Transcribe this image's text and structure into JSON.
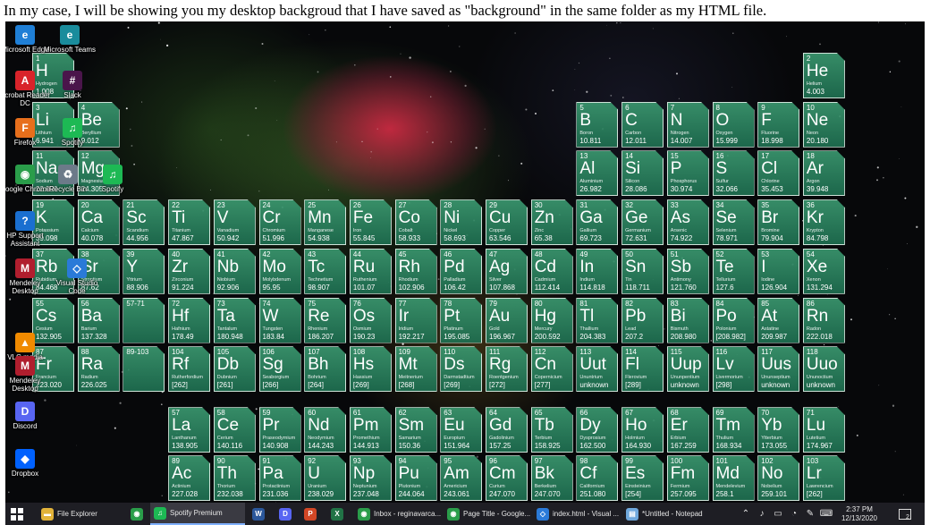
{
  "caption": "In my case, I will be showing you my desktop backgroud that I have saved as \"background\" in the same folder as my HTML file.",
  "elements": [
    {
      "n": "1",
      "s": "H",
      "e": "Hydrogen",
      "w": "1.008",
      "r": 1,
      "c": 1
    },
    {
      "n": "2",
      "s": "He",
      "e": "Helium",
      "w": "4.003",
      "r": 1,
      "c": 18
    },
    {
      "n": "3",
      "s": "Li",
      "e": "Lithium",
      "w": "6.941",
      "r": 2,
      "c": 1
    },
    {
      "n": "4",
      "s": "Be",
      "e": "Beryllium",
      "w": "9.012",
      "r": 2,
      "c": 2
    },
    {
      "n": "5",
      "s": "B",
      "e": "Boron",
      "w": "10.811",
      "r": 2,
      "c": 13
    },
    {
      "n": "6",
      "s": "C",
      "e": "Carbon",
      "w": "12.011",
      "r": 2,
      "c": 14
    },
    {
      "n": "7",
      "s": "N",
      "e": "Nitrogen",
      "w": "14.007",
      "r": 2,
      "c": 15
    },
    {
      "n": "8",
      "s": "O",
      "e": "Oxygen",
      "w": "15.999",
      "r": 2,
      "c": 16
    },
    {
      "n": "9",
      "s": "F",
      "e": "Fluorine",
      "w": "18.998",
      "r": 2,
      "c": 17
    },
    {
      "n": "10",
      "s": "Ne",
      "e": "Neon",
      "w": "20.180",
      "r": 2,
      "c": 18
    },
    {
      "n": "11",
      "s": "Na",
      "e": "Sodium",
      "w": "22.990",
      "r": 3,
      "c": 1
    },
    {
      "n": "12",
      "s": "Mg",
      "e": "Magnesium",
      "w": "24.305",
      "r": 3,
      "c": 2
    },
    {
      "n": "13",
      "s": "Al",
      "e": "Aluminium",
      "w": "26.982",
      "r": 3,
      "c": 13
    },
    {
      "n": "14",
      "s": "Si",
      "e": "Silicon",
      "w": "28.086",
      "r": 3,
      "c": 14
    },
    {
      "n": "15",
      "s": "P",
      "e": "Phosphorus",
      "w": "30.974",
      "r": 3,
      "c": 15
    },
    {
      "n": "16",
      "s": "S",
      "e": "Sulfur",
      "w": "32.066",
      "r": 3,
      "c": 16
    },
    {
      "n": "17",
      "s": "Cl",
      "e": "Chlorine",
      "w": "35.453",
      "r": 3,
      "c": 17
    },
    {
      "n": "18",
      "s": "Ar",
      "e": "Argon",
      "w": "39.948",
      "r": 3,
      "c": 18
    },
    {
      "n": "19",
      "s": "K",
      "e": "Potassium",
      "w": "39.098",
      "r": 4,
      "c": 1
    },
    {
      "n": "20",
      "s": "Ca",
      "e": "Calcium",
      "w": "40.078",
      "r": 4,
      "c": 2
    },
    {
      "n": "21",
      "s": "Sc",
      "e": "Scandium",
      "w": "44.956",
      "r": 4,
      "c": 3
    },
    {
      "n": "22",
      "s": "Ti",
      "e": "Titanium",
      "w": "47.867",
      "r": 4,
      "c": 4
    },
    {
      "n": "23",
      "s": "V",
      "e": "Vanadium",
      "w": "50.942",
      "r": 4,
      "c": 5
    },
    {
      "n": "24",
      "s": "Cr",
      "e": "Chromium",
      "w": "51.996",
      "r": 4,
      "c": 6
    },
    {
      "n": "25",
      "s": "Mn",
      "e": "Manganese",
      "w": "54.938",
      "r": 4,
      "c": 7
    },
    {
      "n": "26",
      "s": "Fe",
      "e": "Iron",
      "w": "55.845",
      "r": 4,
      "c": 8
    },
    {
      "n": "27",
      "s": "Co",
      "e": "Cobalt",
      "w": "58.933",
      "r": 4,
      "c": 9
    },
    {
      "n": "28",
      "s": "Ni",
      "e": "Nickel",
      "w": "58.693",
      "r": 4,
      "c": 10
    },
    {
      "n": "29",
      "s": "Cu",
      "e": "Copper",
      "w": "63.546",
      "r": 4,
      "c": 11
    },
    {
      "n": "30",
      "s": "Zn",
      "e": "Zinc",
      "w": "65.38",
      "r": 4,
      "c": 12
    },
    {
      "n": "31",
      "s": "Ga",
      "e": "Gallium",
      "w": "69.723",
      "r": 4,
      "c": 13
    },
    {
      "n": "32",
      "s": "Ge",
      "e": "Germanium",
      "w": "72.631",
      "r": 4,
      "c": 14
    },
    {
      "n": "33",
      "s": "As",
      "e": "Arsenic",
      "w": "74.922",
      "r": 4,
      "c": 15
    },
    {
      "n": "34",
      "s": "Se",
      "e": "Selenium",
      "w": "78.971",
      "r": 4,
      "c": 16
    },
    {
      "n": "35",
      "s": "Br",
      "e": "Bromine",
      "w": "79.904",
      "r": 4,
      "c": 17
    },
    {
      "n": "36",
      "s": "Kr",
      "e": "Krypton",
      "w": "84.798",
      "r": 4,
      "c": 18
    },
    {
      "n": "37",
      "s": "Rb",
      "e": "Rubidium",
      "w": "84.468",
      "r": 5,
      "c": 1
    },
    {
      "n": "38",
      "s": "Sr",
      "e": "Strontium",
      "w": "87.62",
      "r": 5,
      "c": 2
    },
    {
      "n": "39",
      "s": "Y",
      "e": "Yttrium",
      "w": "88.906",
      "r": 5,
      "c": 3
    },
    {
      "n": "40",
      "s": "Zr",
      "e": "Zirconium",
      "w": "91.224",
      "r": 5,
      "c": 4
    },
    {
      "n": "41",
      "s": "Nb",
      "e": "Niobium",
      "w": "92.906",
      "r": 5,
      "c": 5
    },
    {
      "n": "42",
      "s": "Mo",
      "e": "Molybdenum",
      "w": "95.95",
      "r": 5,
      "c": 6
    },
    {
      "n": "43",
      "s": "Tc",
      "e": "Technetium",
      "w": "98.907",
      "r": 5,
      "c": 7
    },
    {
      "n": "44",
      "s": "Ru",
      "e": "Ruthenium",
      "w": "101.07",
      "r": 5,
      "c": 8
    },
    {
      "n": "45",
      "s": "Rh",
      "e": "Rhodium",
      "w": "102.906",
      "r": 5,
      "c": 9
    },
    {
      "n": "46",
      "s": "Pd",
      "e": "Palladium",
      "w": "106.42",
      "r": 5,
      "c": 10
    },
    {
      "n": "47",
      "s": "Ag",
      "e": "Silver",
      "w": "107.868",
      "r": 5,
      "c": 11
    },
    {
      "n": "48",
      "s": "Cd",
      "e": "Cadmium",
      "w": "112.414",
      "r": 5,
      "c": 12
    },
    {
      "n": "49",
      "s": "In",
      "e": "Indium",
      "w": "114.818",
      "r": 5,
      "c": 13
    },
    {
      "n": "50",
      "s": "Sn",
      "e": "Tin",
      "w": "118.711",
      "r": 5,
      "c": 14
    },
    {
      "n": "51",
      "s": "Sb",
      "e": "Antimony",
      "w": "121.760",
      "r": 5,
      "c": 15
    },
    {
      "n": "52",
      "s": "Te",
      "e": "Tellurium",
      "w": "127.6",
      "r": 5,
      "c": 16
    },
    {
      "n": "53",
      "s": "I",
      "e": "Iodine",
      "w": "126.904",
      "r": 5,
      "c": 17
    },
    {
      "n": "54",
      "s": "Xe",
      "e": "Xenon",
      "w": "131.294",
      "r": 5,
      "c": 18
    },
    {
      "n": "55",
      "s": "Cs",
      "e": "Cesium",
      "w": "132.905",
      "r": 6,
      "c": 1
    },
    {
      "n": "56",
      "s": "Ba",
      "e": "Barium",
      "w": "137.328",
      "r": 6,
      "c": 2
    },
    {
      "n": "57-71",
      "s": "",
      "e": "",
      "w": "",
      "r": 6,
      "c": 3
    },
    {
      "n": "72",
      "s": "Hf",
      "e": "Hafnium",
      "w": "178.49",
      "r": 6,
      "c": 4
    },
    {
      "n": "73",
      "s": "Ta",
      "e": "Tantalum",
      "w": "180.948",
      "r": 6,
      "c": 5
    },
    {
      "n": "74",
      "s": "W",
      "e": "Tungsten",
      "w": "183.84",
      "r": 6,
      "c": 6
    },
    {
      "n": "75",
      "s": "Re",
      "e": "Rhenium",
      "w": "186.207",
      "r": 6,
      "c": 7
    },
    {
      "n": "76",
      "s": "Os",
      "e": "Osmium",
      "w": "190.23",
      "r": 6,
      "c": 8
    },
    {
      "n": "77",
      "s": "Ir",
      "e": "Iridium",
      "w": "192.217",
      "r": 6,
      "c": 9
    },
    {
      "n": "78",
      "s": "Pt",
      "e": "Platinum",
      "w": "195.085",
      "r": 6,
      "c": 10
    },
    {
      "n": "79",
      "s": "Au",
      "e": "Gold",
      "w": "196.967",
      "r": 6,
      "c": 11
    },
    {
      "n": "80",
      "s": "Hg",
      "e": "Mercury",
      "w": "200.592",
      "r": 6,
      "c": 12
    },
    {
      "n": "81",
      "s": "Tl",
      "e": "Thallium",
      "w": "204.383",
      "r": 6,
      "c": 13
    },
    {
      "n": "82",
      "s": "Pb",
      "e": "Lead",
      "w": "207.2",
      "r": 6,
      "c": 14
    },
    {
      "n": "83",
      "s": "Bi",
      "e": "Bismuth",
      "w": "208.980",
      "r": 6,
      "c": 15
    },
    {
      "n": "84",
      "s": "Po",
      "e": "Polonium",
      "w": "[208.982]",
      "r": 6,
      "c": 16
    },
    {
      "n": "85",
      "s": "At",
      "e": "Astatine",
      "w": "209.987",
      "r": 6,
      "c": 17
    },
    {
      "n": "86",
      "s": "Rn",
      "e": "Radon",
      "w": "222.018",
      "r": 6,
      "c": 18
    },
    {
      "n": "87",
      "s": "Fr",
      "e": "Francium",
      "w": "223.020",
      "r": 7,
      "c": 1
    },
    {
      "n": "88",
      "s": "Ra",
      "e": "Radium",
      "w": "226.025",
      "r": 7,
      "c": 2
    },
    {
      "n": "89-103",
      "s": "",
      "e": "",
      "w": "",
      "r": 7,
      "c": 3
    },
    {
      "n": "104",
      "s": "Rf",
      "e": "Rutherfordium",
      "w": "[262]",
      "r": 7,
      "c": 4
    },
    {
      "n": "105",
      "s": "Db",
      "e": "Dubnium",
      "w": "[261]",
      "r": 7,
      "c": 5
    },
    {
      "n": "106",
      "s": "Sg",
      "e": "Seaborgium",
      "w": "[266]",
      "r": 7,
      "c": 6
    },
    {
      "n": "107",
      "s": "Bh",
      "e": "Bohrium",
      "w": "[264]",
      "r": 7,
      "c": 7
    },
    {
      "n": "108",
      "s": "Hs",
      "e": "Hassium",
      "w": "[269]",
      "r": 7,
      "c": 8
    },
    {
      "n": "109",
      "s": "Mt",
      "e": "Meitnerium",
      "w": "[268]",
      "r": 7,
      "c": 9
    },
    {
      "n": "110",
      "s": "Ds",
      "e": "Darmstadtium",
      "w": "[269]",
      "r": 7,
      "c": 10
    },
    {
      "n": "111",
      "s": "Rg",
      "e": "Roentgenium",
      "w": "[272]",
      "r": 7,
      "c": 11
    },
    {
      "n": "112",
      "s": "Cn",
      "e": "Copernicium",
      "w": "[277]",
      "r": 7,
      "c": 12
    },
    {
      "n": "113",
      "s": "Uut",
      "e": "Ununtrium",
      "w": "unknown",
      "r": 7,
      "c": 13
    },
    {
      "n": "114",
      "s": "Fl",
      "e": "Flerovium",
      "w": "[289]",
      "r": 7,
      "c": 14
    },
    {
      "n": "115",
      "s": "Uup",
      "e": "Ununpentium",
      "w": "unknown",
      "r": 7,
      "c": 15
    },
    {
      "n": "116",
      "s": "Lv",
      "e": "Livermorium",
      "w": "[298]",
      "r": 7,
      "c": 16
    },
    {
      "n": "117",
      "s": "Uus",
      "e": "Ununseptium",
      "w": "unknown",
      "r": 7,
      "c": 17
    },
    {
      "n": "118",
      "s": "Uuo",
      "e": "Ununoctium",
      "w": "unknown",
      "r": 7,
      "c": 18
    },
    {
      "n": "57",
      "s": "La",
      "e": "Lanthanum",
      "w": "138.905",
      "r": 8,
      "c": 4
    },
    {
      "n": "58",
      "s": "Ce",
      "e": "Cerium",
      "w": "140.116",
      "r": 8,
      "c": 5
    },
    {
      "n": "59",
      "s": "Pr",
      "e": "Praseodymium",
      "w": "140.908",
      "r": 8,
      "c": 6
    },
    {
      "n": "60",
      "s": "Nd",
      "e": "Neodymium",
      "w": "144.243",
      "r": 8,
      "c": 7
    },
    {
      "n": "61",
      "s": "Pm",
      "e": "Promethium",
      "w": "144.913",
      "r": 8,
      "c": 8
    },
    {
      "n": "62",
      "s": "Sm",
      "e": "Samarium",
      "w": "150.36",
      "r": 8,
      "c": 9
    },
    {
      "n": "63",
      "s": "Eu",
      "e": "Europium",
      "w": "151.964",
      "r": 8,
      "c": 10
    },
    {
      "n": "64",
      "s": "Gd",
      "e": "Gadolinium",
      "w": "157.25",
      "r": 8,
      "c": 11
    },
    {
      "n": "65",
      "s": "Tb",
      "e": "Terbium",
      "w": "158.925",
      "r": 8,
      "c": 12
    },
    {
      "n": "66",
      "s": "Dy",
      "e": "Dysprosium",
      "w": "162.500",
      "r": 8,
      "c": 13
    },
    {
      "n": "67",
      "s": "Ho",
      "e": "Holmium",
      "w": "164.930",
      "r": 8,
      "c": 14
    },
    {
      "n": "68",
      "s": "Er",
      "e": "Erbium",
      "w": "167.259",
      "r": 8,
      "c": 15
    },
    {
      "n": "69",
      "s": "Tm",
      "e": "Thulium",
      "w": "168.934",
      "r": 8,
      "c": 16
    },
    {
      "n": "70",
      "s": "Yb",
      "e": "Ytterbium",
      "w": "173.055",
      "r": 8,
      "c": 17
    },
    {
      "n": "71",
      "s": "Lu",
      "e": "Lutetium",
      "w": "174.967",
      "r": 8,
      "c": 18
    },
    {
      "n": "89",
      "s": "Ac",
      "e": "Actinium",
      "w": "227.028",
      "r": 9,
      "c": 4
    },
    {
      "n": "90",
      "s": "Th",
      "e": "Thorium",
      "w": "232.038",
      "r": 9,
      "c": 5
    },
    {
      "n": "91",
      "s": "Pa",
      "e": "Protactinium",
      "w": "231.036",
      "r": 9,
      "c": 6
    },
    {
      "n": "92",
      "s": "U",
      "e": "Uranium",
      "w": "238.029",
      "r": 9,
      "c": 7
    },
    {
      "n": "93",
      "s": "Np",
      "e": "Neptunium",
      "w": "237.048",
      "r": 9,
      "c": 8
    },
    {
      "n": "94",
      "s": "Pu",
      "e": "Plutonium",
      "w": "244.064",
      "r": 9,
      "c": 9
    },
    {
      "n": "95",
      "s": "Am",
      "e": "Americium",
      "w": "243.061",
      "r": 9,
      "c": 10
    },
    {
      "n": "96",
      "s": "Cm",
      "e": "Curium",
      "w": "247.070",
      "r": 9,
      "c": 11
    },
    {
      "n": "97",
      "s": "Bk",
      "e": "Berkelium",
      "w": "247.070",
      "r": 9,
      "c": 12
    },
    {
      "n": "98",
      "s": "Cf",
      "e": "Californium",
      "w": "251.080",
      "r": 9,
      "c": 13
    },
    {
      "n": "99",
      "s": "Es",
      "e": "Einsteinium",
      "w": "[254]",
      "r": 9,
      "c": 14
    },
    {
      "n": "100",
      "s": "Fm",
      "e": "Fermium",
      "w": "257.095",
      "r": 9,
      "c": 15
    },
    {
      "n": "101",
      "s": "Md",
      "e": "Mendelevium",
      "w": "258.1",
      "r": 9,
      "c": 16
    },
    {
      "n": "102",
      "s": "No",
      "e": "Nobelium",
      "w": "259.101",
      "r": 9,
      "c": 17
    },
    {
      "n": "103",
      "s": "Lr",
      "e": "Lawrencium",
      "w": "[262]",
      "r": 9,
      "c": 18
    }
  ],
  "desktop_icons": [
    {
      "label": "Microsoft Edge",
      "glyph": "e",
      "color": "#1f7fd6",
      "icon": "edge-icon"
    },
    {
      "label": "Acrobat Reader DC",
      "glyph": "A",
      "color": "#d8232a",
      "icon": "acrobat-icon"
    },
    {
      "label": "Firefox",
      "glyph": "F",
      "color": "#e76f1c",
      "icon": "firefox-icon"
    },
    {
      "label": "Google Chrome",
      "glyph": "◉",
      "color": "#2a9d4a",
      "icon": "chrome-icon"
    },
    {
      "label": "HP Support Assistant",
      "glyph": "?",
      "color": "#1a6fd0",
      "icon": "hp-support-icon"
    },
    {
      "label": "Mendeley Desktop",
      "glyph": "M",
      "color": "#b01e2e",
      "icon": "mendeley-icon"
    },
    {
      "label": "VLC media player",
      "glyph": "▲",
      "color": "#f08a00",
      "icon": "vlc-icon"
    },
    {
      "label": "Mendeley Desktop",
      "glyph": "M",
      "color": "#b01e2e",
      "icon": "mendeley-icon"
    },
    {
      "label": "Discord",
      "glyph": "D",
      "color": "#5865f2",
      "icon": "discord-icon"
    },
    {
      "label": "Dropbox",
      "glyph": "◆",
      "color": "#0061fe",
      "icon": "dropbox-icon"
    }
  ],
  "desktop_icons_col2": [
    {
      "label": "Microsoft Teams",
      "glyph": "e",
      "color": "#1a8c9c",
      "icon": "teams-icon"
    },
    {
      "label": "Slack",
      "glyph": "#",
      "color": "#4a154b",
      "icon": "slack-icon"
    },
    {
      "label": "Spotify",
      "glyph": "♫",
      "color": "#1db954",
      "icon": "spotify-icon"
    },
    {
      "label": "Recycle Bin",
      "glyph": "♻",
      "color": "#6c7a89",
      "icon": "recycle-bin-icon"
    },
    {
      "label": "Spotify",
      "glyph": "♫",
      "color": "#1db954",
      "icon": "spotify-icon"
    },
    {
      "label": "Visual Studio Code",
      "glyph": "◇",
      "color": "#2a7ad8",
      "icon": "vscode-icon"
    }
  ],
  "taskbar": {
    "start_icon": "windows-start-icon",
    "items": [
      {
        "label": "File Explorer",
        "glyph": "▬",
        "color": "#e2b33a",
        "icon": "file-explorer-icon",
        "active": false
      },
      {
        "label": "",
        "glyph": "◉",
        "color": "#2a9d4a",
        "icon": "chrome-icon",
        "active": false
      },
      {
        "label": "Spotify Premium",
        "glyph": "♫",
        "color": "#1db954",
        "icon": "spotify-icon",
        "active": true
      },
      {
        "label": "",
        "glyph": "W",
        "color": "#2b579a",
        "icon": "word-icon",
        "active": false
      },
      {
        "label": "",
        "glyph": "D",
        "color": "#5865f2",
        "icon": "discord-icon",
        "active": false
      },
      {
        "label": "",
        "glyph": "P",
        "color": "#d24726",
        "icon": "powerpoint-icon",
        "active": false
      },
      {
        "label": "",
        "glyph": "X",
        "color": "#217346",
        "icon": "excel-icon",
        "active": false
      },
      {
        "label": "Inbox - reginavarca...",
        "glyph": "◉",
        "color": "#2a9d4a",
        "icon": "chrome-icon",
        "active": false
      },
      {
        "label": "Page Title - Google...",
        "glyph": "◉",
        "color": "#2a9d4a",
        "icon": "chrome-icon",
        "active": false
      },
      {
        "label": "index.html - Visual ...",
        "glyph": "◇",
        "color": "#2a7ad8",
        "icon": "vscode-icon",
        "active": false
      },
      {
        "label": "*Untitled - Notepad",
        "glyph": "▤",
        "color": "#6fa8dc",
        "icon": "notepad-icon",
        "active": false
      }
    ],
    "tray_icons": [
      "chevron-up-icon",
      "volume-icon",
      "battery-icon",
      "network-icon",
      "pen-icon",
      "language-icon"
    ],
    "time": "2:37 PM",
    "date": "12/13/2020",
    "notification_count": "2"
  }
}
